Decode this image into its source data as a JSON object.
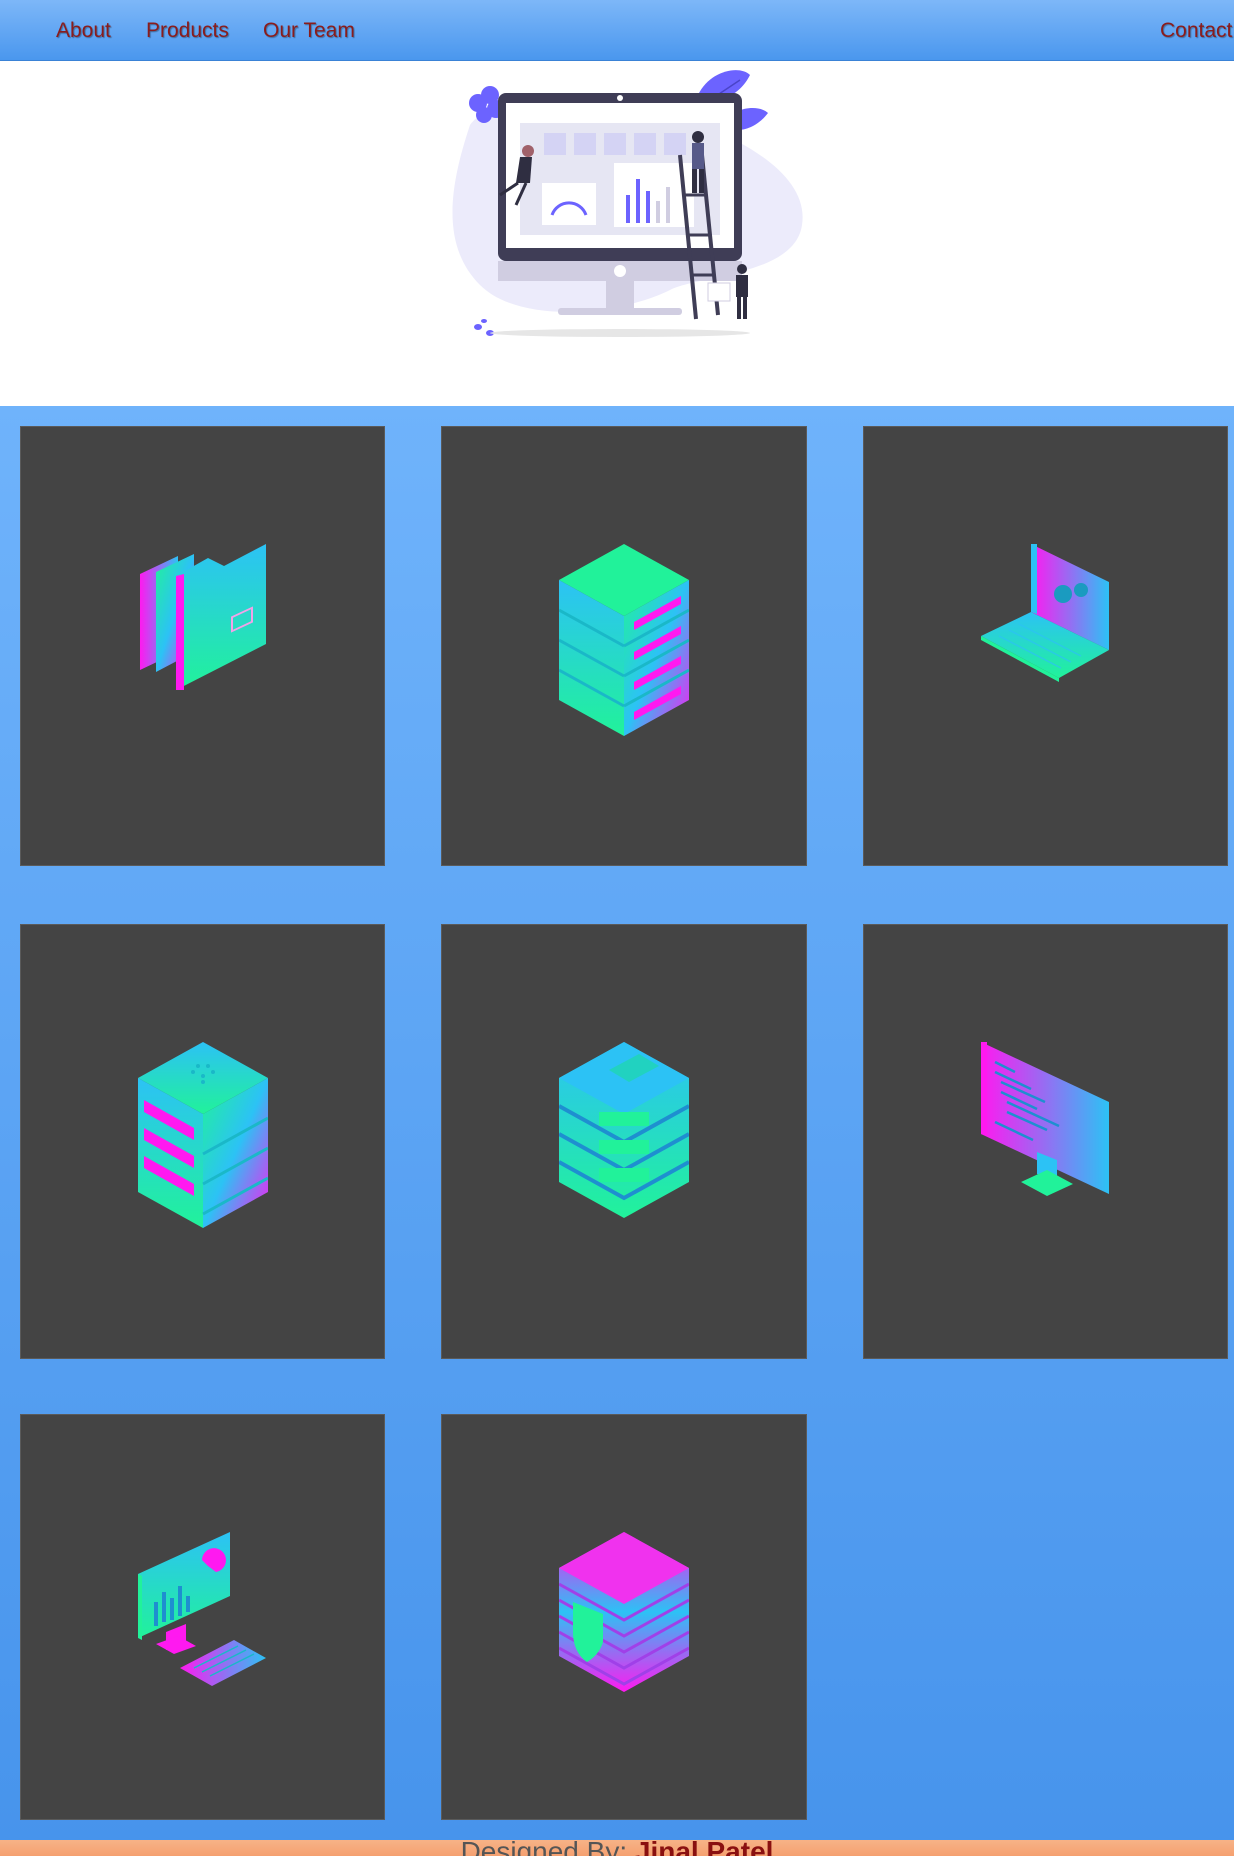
{
  "nav": {
    "items": [
      {
        "label": "About"
      },
      {
        "label": "Products"
      },
      {
        "label": "Our Team"
      }
    ],
    "contact_label": "Contact"
  },
  "hero": {
    "illustration": "dashboard-monitor-illustration"
  },
  "products": [
    {
      "icon": "folders-icon"
    },
    {
      "icon": "server-stack-icon"
    },
    {
      "icon": "laptop-settings-icon"
    },
    {
      "icon": "server-rack-icon"
    },
    {
      "icon": "database-icon"
    },
    {
      "icon": "code-monitor-icon"
    },
    {
      "icon": "analytics-desktop-icon"
    },
    {
      "icon": "secure-database-icon"
    }
  ],
  "footer": {
    "prefix": "Designed By:",
    "name": "Jinal Patel"
  },
  "colors": {
    "nav_bg": "#5aa3f2",
    "nav_text": "#8a1c1c",
    "grid_bg": "#5ca6f6",
    "card_bg": "#444444",
    "footer_bg": "#f5a878",
    "icon_gradient_a": "#21f29a",
    "icon_gradient_b": "#2cc2f5",
    "icon_gradient_c": "#ff19f0"
  }
}
